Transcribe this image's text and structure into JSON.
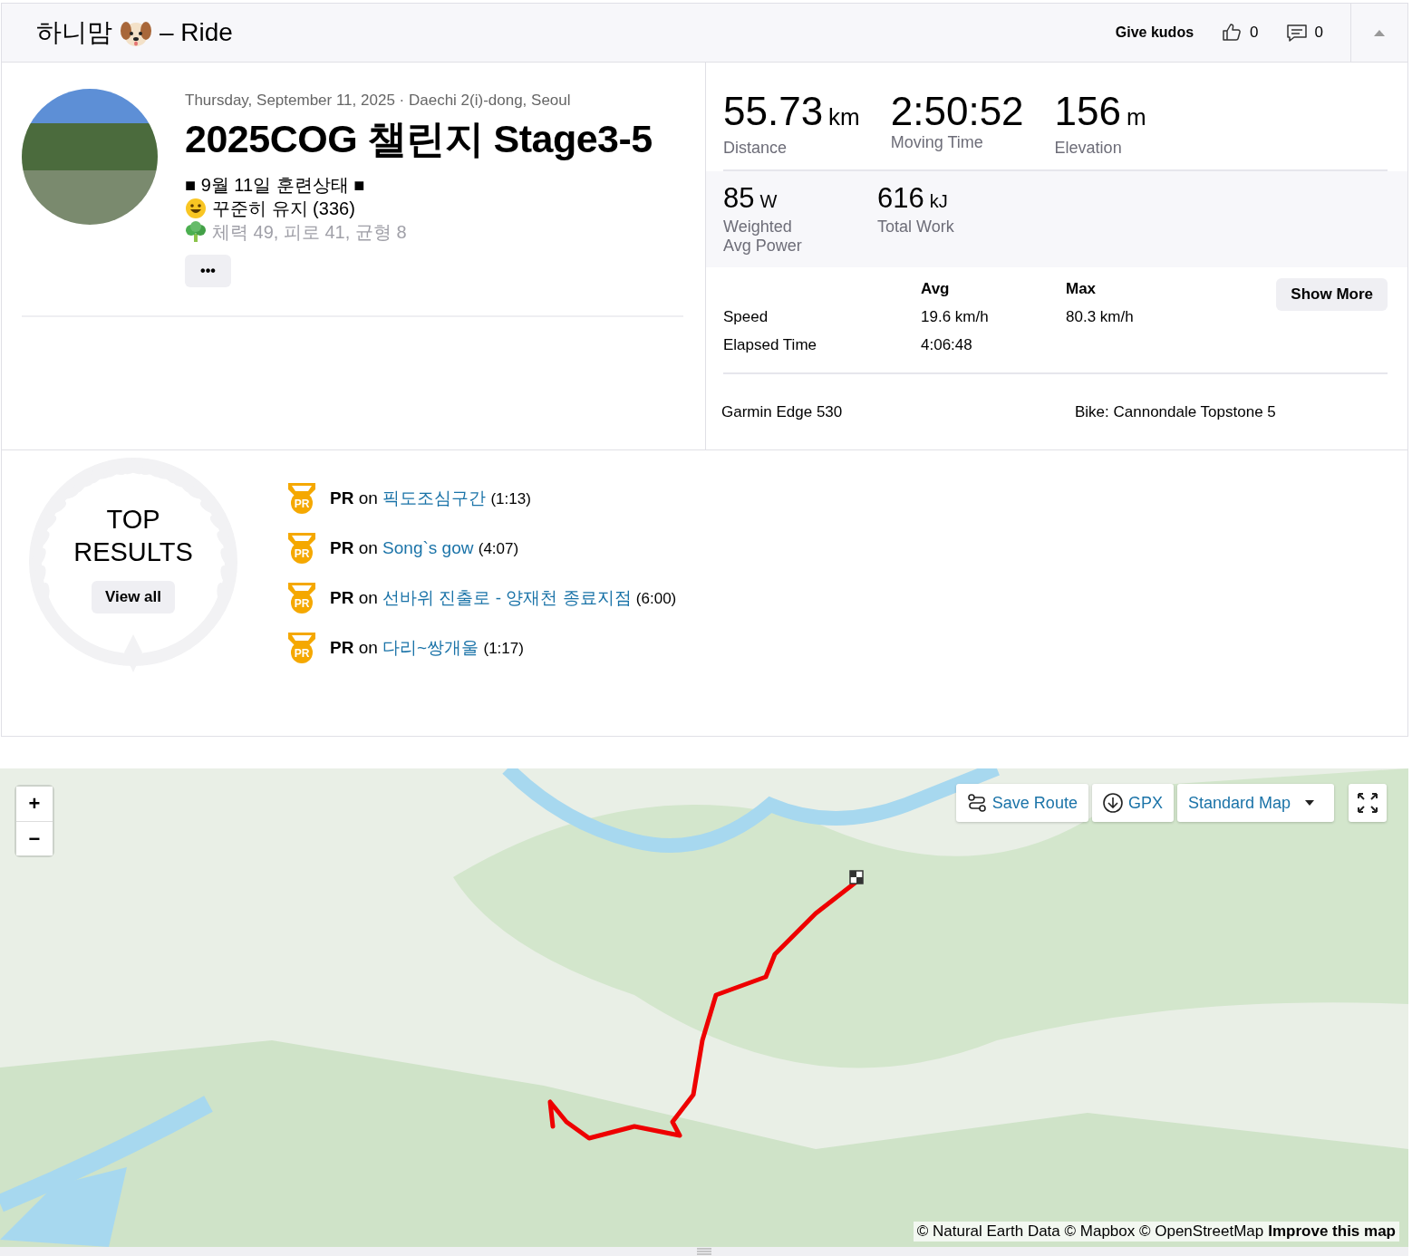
{
  "header": {
    "athlete": "하니맘",
    "activity_type": "– Ride",
    "give_kudos": "Give kudos",
    "kudos_count": "0",
    "comment_count": "0"
  },
  "activity": {
    "date_location": "Thursday, September 11, 2025 · Daechi 2(i)-dong, Seoul",
    "title": "2025COG 챌린지 Stage3-5",
    "description_lines": [
      {
        "kind": "plain",
        "text": "■ 9월 11일 훈련상태 ■",
        "faded": false
      },
      {
        "kind": "smiley",
        "text": "꾸준히 유지 (336)",
        "faded": false
      },
      {
        "kind": "broccoli",
        "text": "체력 49, 피로 41, 균형 8",
        "faded": true
      }
    ],
    "more_button": "•••"
  },
  "primary_stats": [
    {
      "value": "55.73",
      "unit": "km",
      "label": "Distance"
    },
    {
      "value": "2:50:52",
      "label": "Moving Time"
    },
    {
      "value": "156",
      "unit": "m",
      "label": "Elevation"
    }
  ],
  "secondary_stats": [
    {
      "value": "85",
      "unit": "W",
      "label": "Weighted Avg Power"
    },
    {
      "value": "616",
      "unit": "kJ",
      "label": "Total Work"
    }
  ],
  "more_stats": {
    "columns": [
      "Avg",
      "Max"
    ],
    "show_more": "Show More",
    "rows": [
      {
        "label": "Speed",
        "avg": "19.6 km/h",
        "max": "80.3 km/h"
      },
      {
        "label": "Elapsed Time",
        "avg": "4:06:48"
      }
    ]
  },
  "device": "Garmin Edge 530",
  "bike": "Bike: Cannondale Topstone 5",
  "top_results": {
    "title": "TOP RESULTS",
    "view_all": "View all",
    "achievements": [
      {
        "badge": "PR",
        "prefix": "PR",
        "connector": "on",
        "segment": "픽도조심구간",
        "time": "(1:13)"
      },
      {
        "badge": "PR",
        "prefix": "PR",
        "connector": "on",
        "segment": "Song`s gow",
        "time": "(4:07)"
      },
      {
        "badge": "PR",
        "prefix": "PR",
        "connector": "on",
        "segment": "선바위 진출로 - 양재천 종료지점",
        "time": "(6:00)"
      },
      {
        "badge": "PR",
        "prefix": "PR",
        "connector": "on",
        "segment": "다리~쌍개울",
        "time": "(1:17)"
      }
    ]
  },
  "map": {
    "zoom_in": "+",
    "zoom_out": "−",
    "save_route": "Save Route",
    "gpx": "GPX",
    "map_style": "Standard Map",
    "attribution": "© Natural Earth Data © Mapbox © OpenStreetMap",
    "improve": "Improve this map"
  }
}
